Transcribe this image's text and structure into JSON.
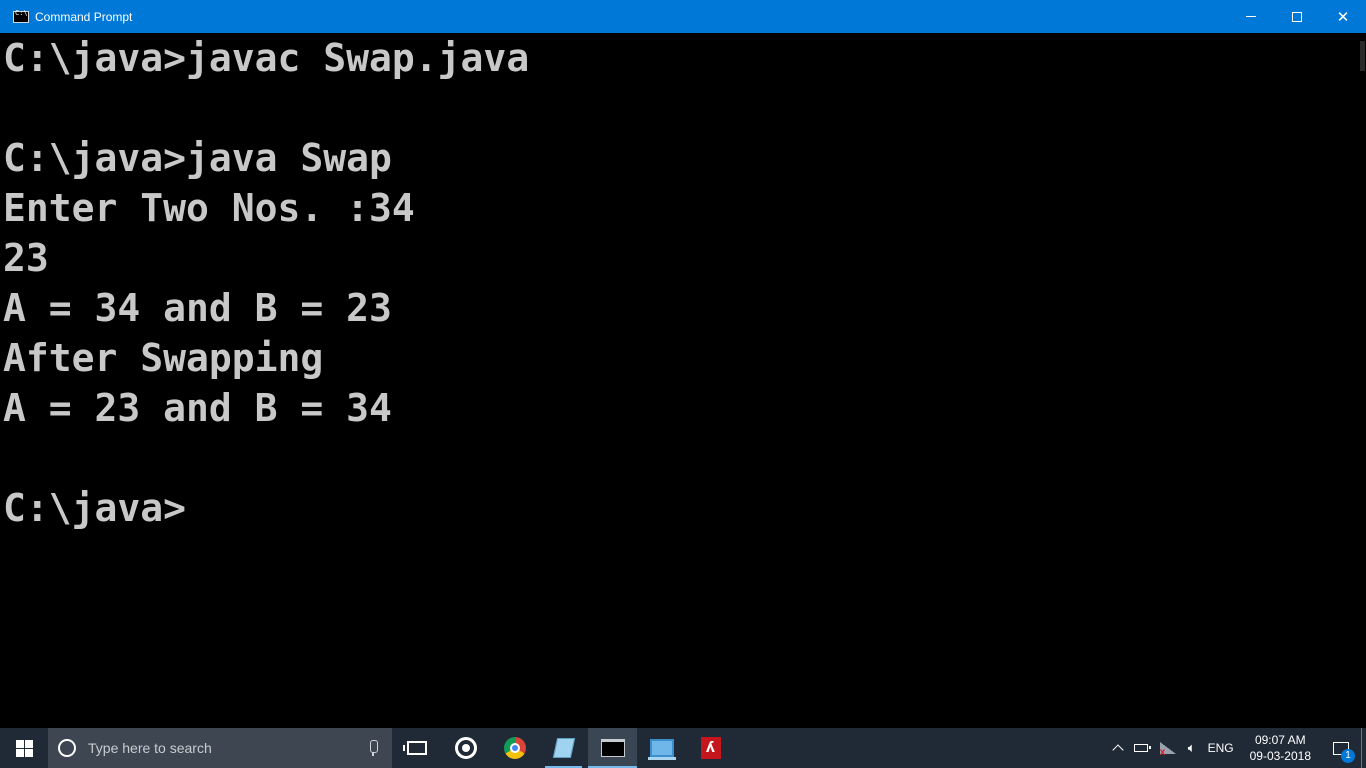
{
  "window": {
    "title": "Command Prompt",
    "controls": {
      "minimize": "minimize-icon",
      "maximize": "maximize-icon",
      "close": "close-icon"
    }
  },
  "console": {
    "lines": [
      "C:\\java>javac Swap.java",
      "",
      "C:\\java>java Swap",
      "Enter Two Nos. :34",
      "23",
      "A = 34 and B = 23",
      "After Swapping",
      "A = 23 and B = 34",
      "",
      "C:\\java>"
    ],
    "text_color": "#c8c8c8",
    "background": "#000000"
  },
  "taskbar": {
    "search_placeholder": "Type here to search",
    "pinned": [
      "task-view-icon",
      "cortana-ring-icon",
      "chrome-icon",
      "notepad-icon",
      "command-prompt-icon",
      "this-pc-icon",
      "acrobat-pdf-icon"
    ],
    "tray": {
      "language": "ENG",
      "time": "09:07 AM",
      "date": "09-03-2018",
      "notification_count": "1"
    }
  }
}
